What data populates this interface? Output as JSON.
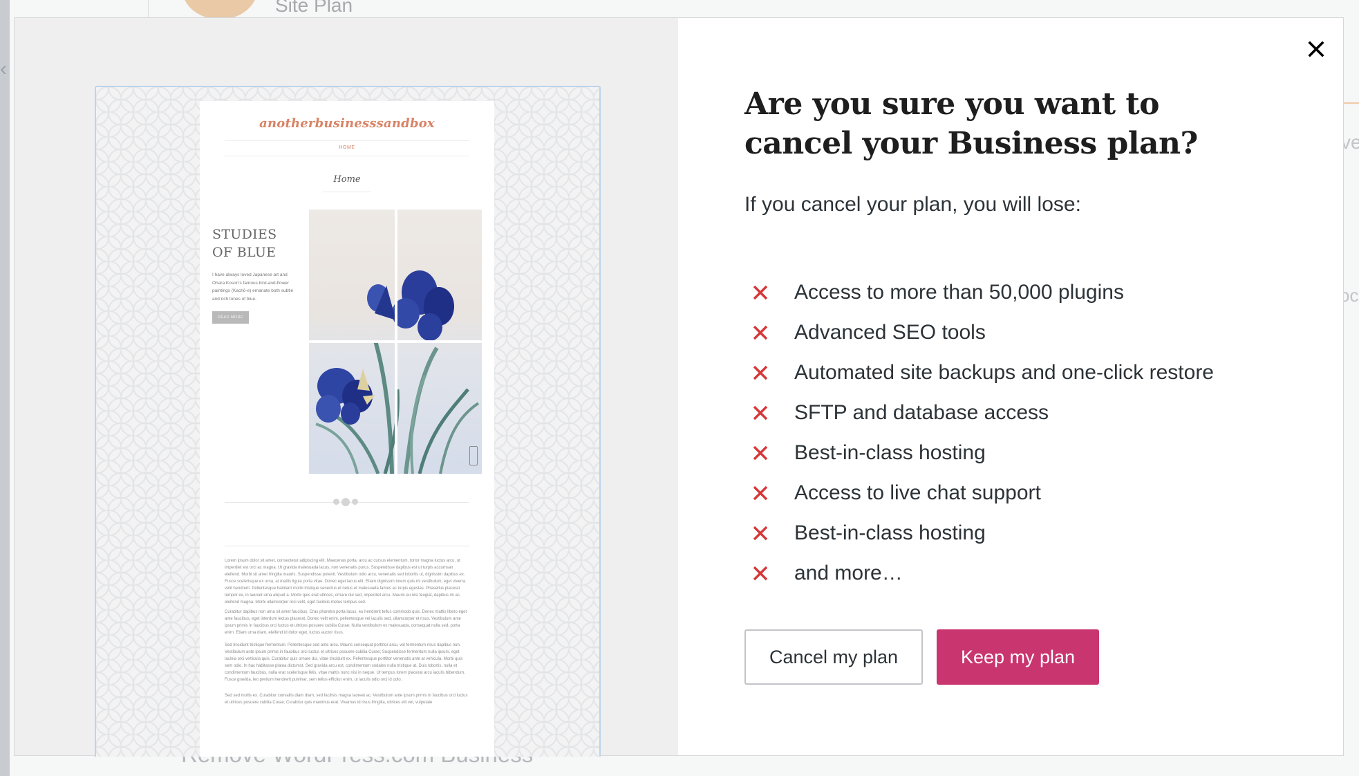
{
  "background": {
    "site_label": "Site Plan",
    "footer_text": "Remove WordPress.com Business",
    "right_fragment_1": "ve",
    "right_fragment_2": "oc"
  },
  "modal": {
    "close_icon": "close-icon",
    "heading": "Are you sure you want to cancel your Business plan?",
    "intro": "If you cancel your plan, you will lose:",
    "loss_items": [
      "Access to more than 50,000 plugins",
      "Advanced SEO tools",
      "Automated site backups and one-click restore",
      "SFTP and database access",
      "Best-in-class hosting",
      "Access to live chat support",
      "Best-in-class hosting",
      "and more…"
    ],
    "cancel_button": "Cancel my plan",
    "keep_button": "Keep my plan",
    "colors": {
      "accent": "#c9356e",
      "x_icon": "#d63638"
    }
  },
  "preview": {
    "site_title": "anotherbusinesssandbox",
    "nav_home": "HOME",
    "page_title": "Home",
    "post_title_line1": "STUDIES",
    "post_title_line2": "OF BLUE",
    "post_excerpt": "I have always loved Japanese art and Ohara Koson's famous bird-and-flower paintings (Kachō-e) emanate both subtle and rich tones of blue.",
    "read_more": "READ MORE",
    "paragraphs": [
      "Lorem ipsum dolor sit amet, consectetur adipiscing elit. Maecenas porta, arcu ac cursus elementum, tortor magna luctus arcu, ut imperdiet est orci ac magna. Ut gravida malesuada lacus, non venenatis purus. Suspendisse dapibus est ut turpis accumsan eleifend. Morbi sit amet fringilla mauris. Suspendisse potenti. Vestibulum odio arcu, venenatis sed lobortis ut, dignissim dapibus ex. Fusce scelerisque ex urna, at mattis ligula porta vitae. Donec eget lacus elit. Etiam dignissim lorem quis mi vestibulum, eget viverra velit hendrerit. Pellentesque habitant morbi tristique senectus et netus et malesuada fames ac turpis egestas. Phasellus placerat tempor ex, in laoreet urna aliquet a. Morbi quis erat ultrices, ornare dui sed, imperdiet arcu. Mauris eu nisi feugiat, dapibus mi ac, eleifend magna. Morbi ullamcorper orci velit, eget facilisis metus tempus sed.",
      "Curabitur dapibus non urna sit amet faucibus. Cras pharetra porta lacus, eu hendrerit tellus commodo quis. Donec mattis libero eget ante faucibus, eget interdum lectus placerat. Donec velit enim, pellentesque vel iaculis sed, ullamcorper et risus. Vestibulum ante ipsum primis in faucibus orci luctus et ultrices posuere cubilia Curae; Nulla vestibulum ex malesuada, consequat nulla sed, porta enim. Etiam urna diam, eleifend id dolor eget, luctus auctor risus.",
      "Sed tincidunt tristique fermentum. Pellentesque sed ante arcu. Mauris consequat porttitor arcu, vel fermentum risus dapibus non. Vestibulum ante ipsum primis in faucibus orci luctus et ultrices posuere cubilia Curae; Suspendisse fermentum nulla ipsum, eget lacinia orci vehicula quis. Curabitur quis ornare dui, vitae tincidunt ex. Pellentesque porttitor venenatis ante at vehicula. Morbi quis sem odio. In hac habitasse platea dictumst. Sed gravida arcu est, condimentum sodales nulla tristique at. Duis lobortis, nulla et condimentum faucibus, nulla erat scelerisque felis, vitae mattis nunc nisi in neque. Ut tempus lorem placerat arcu iaculis bibendum. Fusce gravida, leo pretium hendrerit pulvinar, sem tellus efficitur enim, ut iaculis odio orci id odio.",
      "Sed sed mollis ex. Curabitur convallis diam diam, sed facilisis magna laoreet ac. Vestibulum ante ipsum primis in faucibus orci luctus et ultrices posuere cubilia Curae; Curabitur quis maximus erat. Vivamus id risus fringilla, ultrices elit vel, vulputate"
    ],
    "image": "iris-painting"
  }
}
